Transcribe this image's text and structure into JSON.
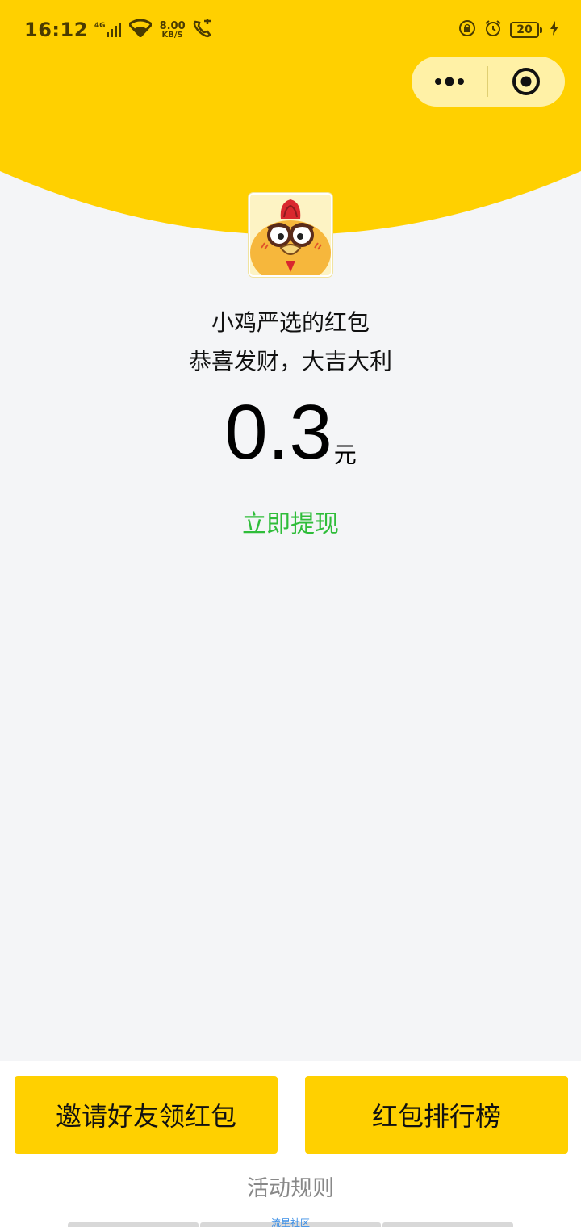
{
  "status_bar": {
    "time": "16:12",
    "network": "4G",
    "speed_value": "8.00",
    "speed_unit": "KB/S",
    "battery": "20"
  },
  "capsule": {
    "more_icon": "more-dots-icon",
    "close_icon": "target-circle-icon"
  },
  "red_packet": {
    "sender": "小鸡严选的红包",
    "wish": "恭喜发财，大吉大利",
    "amount": "0.3",
    "unit": "元",
    "withdraw_label": "立即提现"
  },
  "actions": {
    "invite_label": "邀请好友领红包",
    "ranking_label": "红包排行榜",
    "rules_label": "活动规则",
    "footer_link": "流星社区"
  },
  "colors": {
    "brand_yellow": "#ffd000",
    "withdraw_green": "#2fbd3a",
    "background": "#f4f5f7"
  }
}
